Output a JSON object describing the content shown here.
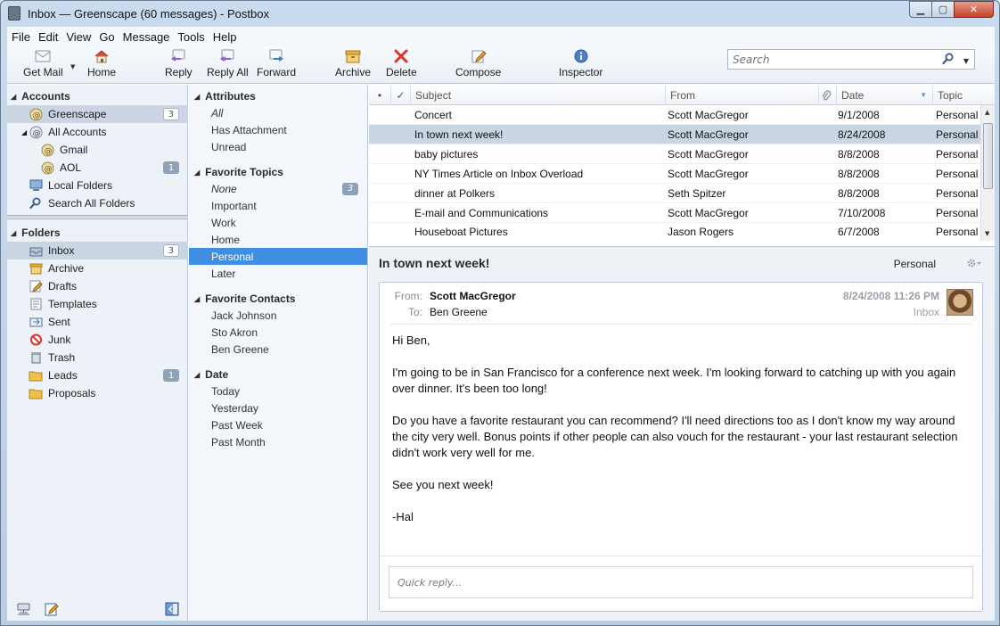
{
  "window": {
    "title": "Inbox — Greenscape (60 messages) - Postbox"
  },
  "menu": [
    "File",
    "Edit",
    "View",
    "Go",
    "Message",
    "Tools",
    "Help"
  ],
  "toolbar": {
    "get_mail": "Get Mail",
    "home": "Home",
    "reply": "Reply",
    "reply_all": "Reply All",
    "forward": "Forward",
    "archive": "Archive",
    "delete": "Delete",
    "compose": "Compose",
    "inspector": "Inspector"
  },
  "search": {
    "placeholder": "Search"
  },
  "sidebar": {
    "accounts_header": "Accounts",
    "accounts": [
      {
        "label": "Greenscape",
        "count": "3"
      },
      {
        "label": "All Accounts"
      },
      {
        "label": "Gmail"
      },
      {
        "label": "AOL",
        "count": "1"
      },
      {
        "label": "Local Folders"
      },
      {
        "label": "Search All Folders"
      }
    ],
    "folders_header": "Folders",
    "folders": [
      {
        "label": "Inbox",
        "count": "3"
      },
      {
        "label": "Archive"
      },
      {
        "label": "Drafts"
      },
      {
        "label": "Templates"
      },
      {
        "label": "Sent"
      },
      {
        "label": "Junk"
      },
      {
        "label": "Trash"
      },
      {
        "label": "Leads",
        "count": "1"
      },
      {
        "label": "Proposals"
      }
    ]
  },
  "filters": {
    "attributes": {
      "header": "Attributes",
      "items": [
        "All",
        "Has Attachment",
        "Unread"
      ]
    },
    "topics": {
      "header": "Favorite Topics",
      "items": [
        "None",
        "Important",
        "Work",
        "Home",
        "Personal",
        "Later"
      ],
      "none_count": "3"
    },
    "contacts": {
      "header": "Favorite Contacts",
      "items": [
        "Jack Johnson",
        "Sto Akron",
        "Ben Greene"
      ]
    },
    "date": {
      "header": "Date",
      "items": [
        "Today",
        "Yesterday",
        "Past Week",
        "Past Month"
      ]
    }
  },
  "message_list": {
    "columns": {
      "subject": "Subject",
      "from": "From",
      "date": "Date",
      "topic": "Topic"
    },
    "rows": [
      {
        "subject": "Concert",
        "from": "Scott MacGregor",
        "date": "9/1/2008",
        "topic": "Personal"
      },
      {
        "subject": "In town next week!",
        "from": "Scott MacGregor",
        "date": "8/24/2008",
        "topic": "Personal"
      },
      {
        "subject": "baby pictures",
        "from": "Scott MacGregor",
        "date": "8/8/2008",
        "topic": "Personal"
      },
      {
        "subject": "NY Times Article on Inbox Overload",
        "from": "Scott MacGregor",
        "date": "8/8/2008",
        "topic": "Personal"
      },
      {
        "subject": "dinner at Polkers",
        "from": "Seth Spitzer",
        "date": "8/8/2008",
        "topic": "Personal"
      },
      {
        "subject": "E-mail and Communications",
        "from": "Scott MacGregor",
        "date": "7/10/2008",
        "topic": "Personal"
      },
      {
        "subject": "Houseboat Pictures",
        "from": "Jason Rogers",
        "date": "6/7/2008",
        "topic": "Personal"
      }
    ]
  },
  "reading": {
    "subject": "In town next week!",
    "topic": "Personal",
    "from_label": "From:",
    "from": "Scott MacGregor",
    "to_label": "To:",
    "to": "Ben Greene",
    "date": "8/24/2008 11:26 PM",
    "folder": "Inbox",
    "body": [
      "Hi Ben,",
      "I'm going to be in San Francisco for a conference next week. I'm looking forward to catching up with you again over dinner. It's been too long!",
      "Do you have a favorite restaurant you can recommend? I'll need directions too as I don't know my way around the city very well. Bonus points if other people can also vouch for the restaurant - your last restaurant selection didn't work very well for me.",
      "See you next week!",
      "-Hal"
    ],
    "quick_reply_placeholder": "Quick reply..."
  },
  "colors": {
    "selection": "#c9d5e3",
    "filter_selected": "#3f8ee2",
    "delete_red": "#d9342b"
  }
}
